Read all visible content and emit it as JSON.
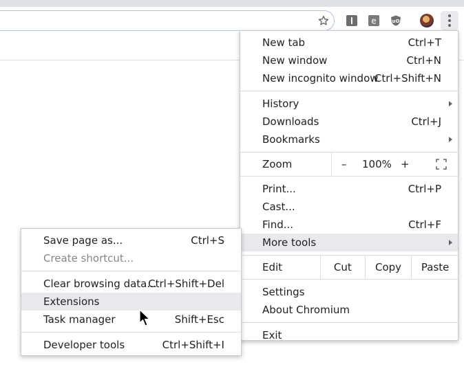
{
  "toolbar": {
    "star": "star-icon",
    "extensions": [
      "instapaper-icon",
      "evernote-icon",
      "ublock-icon"
    ],
    "avatar": "profile-avatar",
    "menu_icon": "three-dots-icon"
  },
  "menu": {
    "new_tab": {
      "label": "New tab",
      "shortcut": "Ctrl+T"
    },
    "new_window": {
      "label": "New window",
      "shortcut": "Ctrl+N"
    },
    "new_incognito": {
      "label": "New incognito window",
      "shortcut": "Ctrl+Shift+N"
    },
    "history": {
      "label": "History"
    },
    "downloads": {
      "label": "Downloads",
      "shortcut": "Ctrl+J"
    },
    "bookmarks": {
      "label": "Bookmarks"
    },
    "zoom": {
      "label": "Zoom",
      "minus": "–",
      "value": "100%",
      "plus": "+"
    },
    "print": {
      "label": "Print...",
      "shortcut": "Ctrl+P"
    },
    "cast": {
      "label": "Cast..."
    },
    "find": {
      "label": "Find...",
      "shortcut": "Ctrl+F"
    },
    "more_tools": {
      "label": "More tools"
    },
    "edit": {
      "label": "Edit",
      "cut": "Cut",
      "copy": "Copy",
      "paste": "Paste"
    },
    "settings": {
      "label": "Settings"
    },
    "about": {
      "label": "About Chromium"
    },
    "exit": {
      "label": "Exit"
    }
  },
  "submenu": {
    "save_page": {
      "label": "Save page as...",
      "shortcut": "Ctrl+S"
    },
    "create_shortcut": {
      "label": "Create shortcut..."
    },
    "clear_data": {
      "label": "Clear browsing data...",
      "shortcut": "Ctrl+Shift+Del"
    },
    "extensions": {
      "label": "Extensions"
    },
    "task_manager": {
      "label": "Task manager",
      "shortcut": "Shift+Esc"
    },
    "dev_tools": {
      "label": "Developer tools",
      "shortcut": "Ctrl+Shift+I"
    }
  },
  "colors": {
    "highlight": "#e8e9ed",
    "separator": "#dadce0",
    "omnibox_border": "#a7c4ef"
  }
}
